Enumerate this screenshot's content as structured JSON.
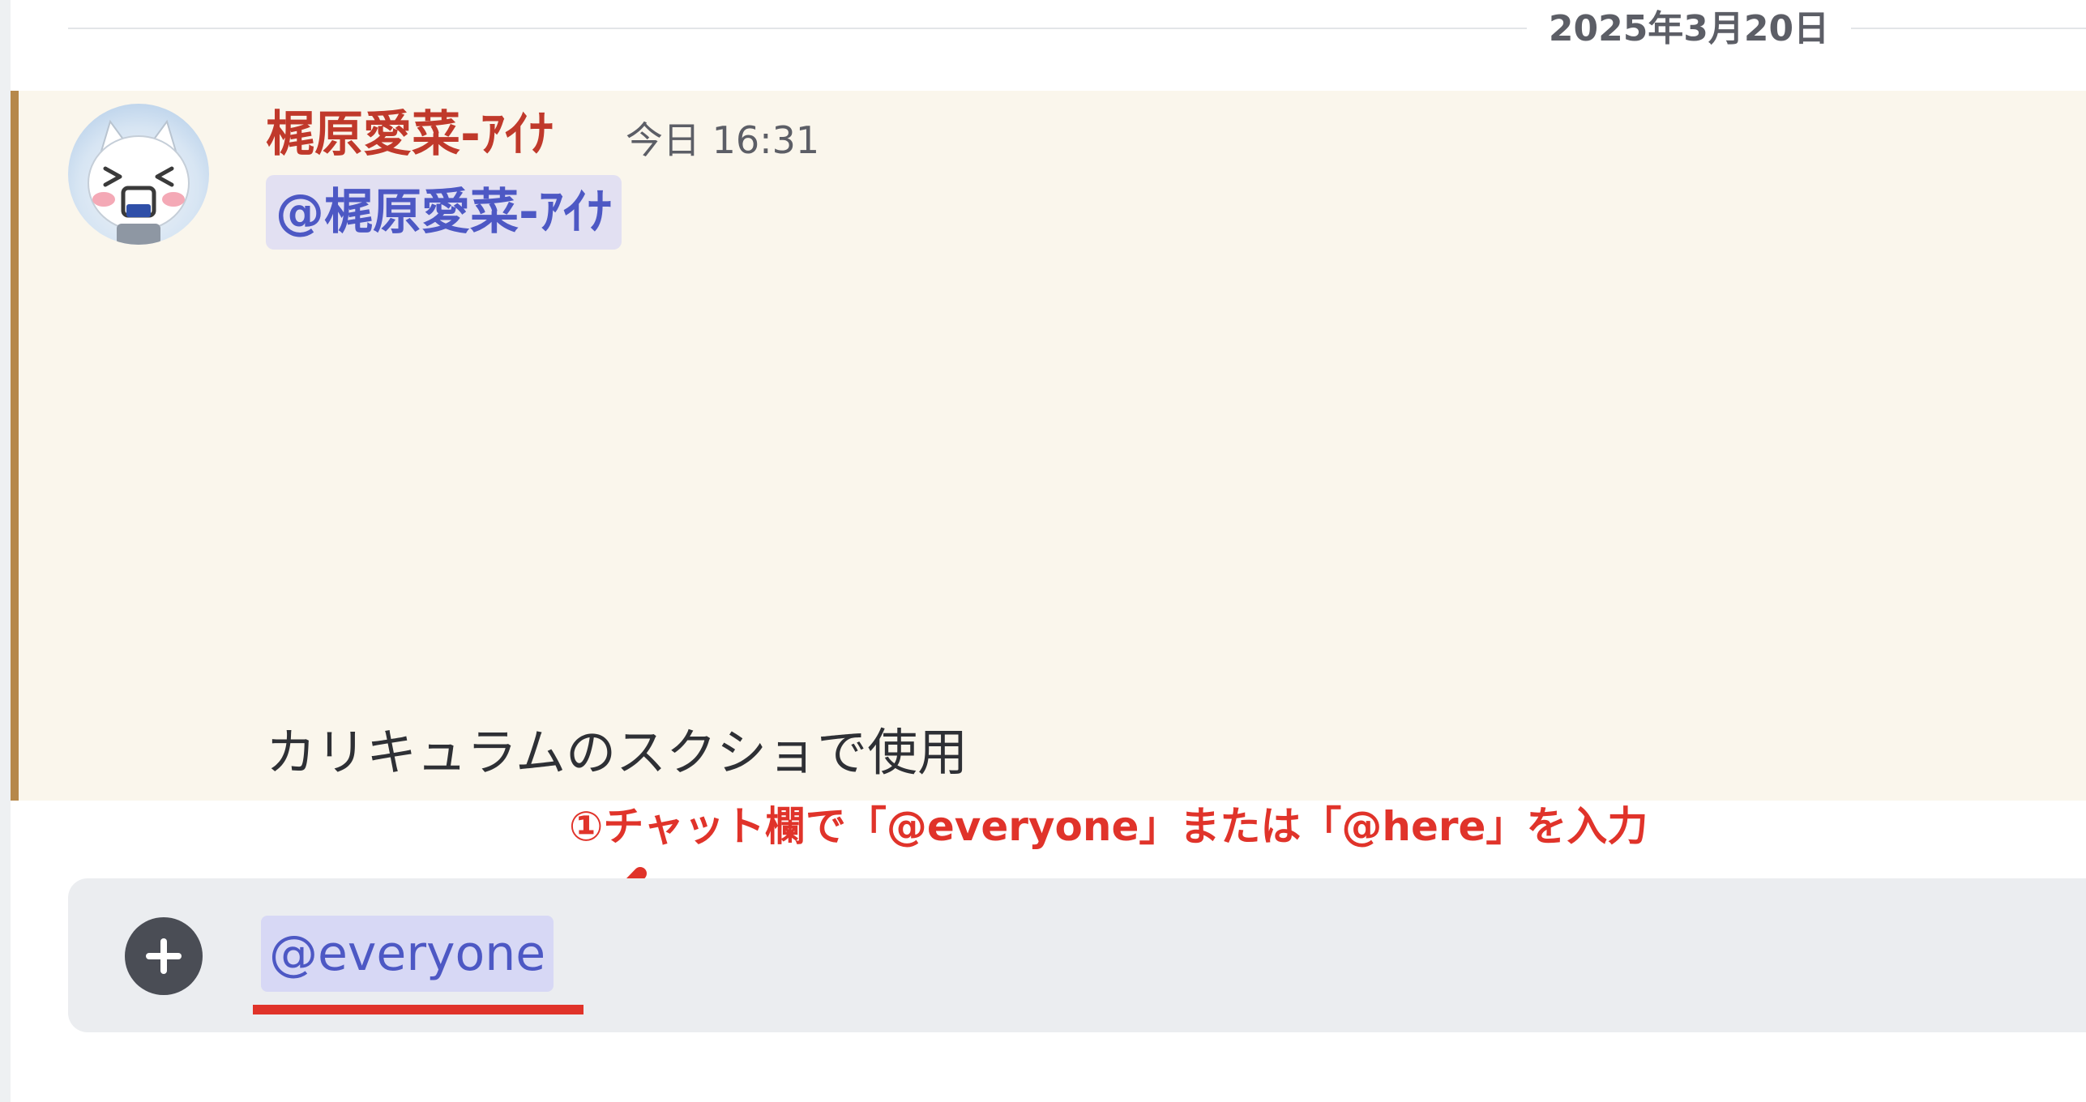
{
  "date_divider": {
    "text": "2025年3月20日"
  },
  "message": {
    "username": "梶原愛菜-ｱｲﾅ",
    "timestamp": "今日 16:31",
    "mention": "@梶原愛菜-ｱｲﾅ",
    "body": "カリキュラムのスクショで使用"
  },
  "annotation": {
    "text": "①チャット欄で「@everyone」または「@here」を入力"
  },
  "chat_input": {
    "attach_icon": "plus-circle-icon",
    "value": "@everyone"
  },
  "colors": {
    "username": "#c0392b",
    "mention_text": "#4d58c4",
    "mention_bg": "#e2e0f2",
    "highlight_bg": "#faf6ec",
    "highlight_bar": "#b6884a",
    "annotation": "#e0332a",
    "input_bg": "#ebedf0"
  }
}
